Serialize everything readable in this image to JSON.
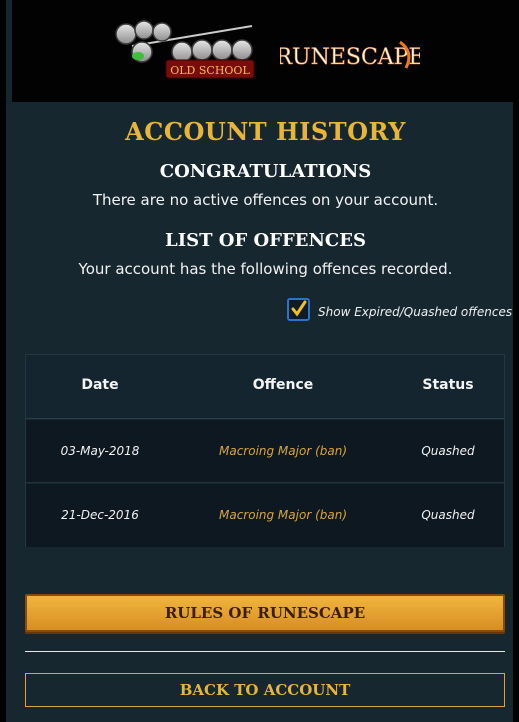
{
  "logos": {
    "osrs_text_1": "RuneScape",
    "osrs_text_2": "OLD SCHOOL",
    "rs_text": "RUNESCAPE"
  },
  "page": {
    "title": "ACCOUNT HISTORY",
    "congrats_heading": "CONGRATULATIONS",
    "congrats_text": "There are no active offences on your account.",
    "list_heading": "LIST OF OFFENCES",
    "list_text": "Your account has the following offences recorded."
  },
  "filter": {
    "label": "Show Expired/Quashed offences",
    "checked": true
  },
  "table": {
    "headers": [
      "Date",
      "Offence",
      "Status"
    ],
    "rows": [
      {
        "date": "03-May-2018",
        "offence": "Macroing Major (ban)",
        "status": "Quashed"
      },
      {
        "date": "21-Dec-2016",
        "offence": "Macroing Major (ban)",
        "status": "Quashed"
      }
    ]
  },
  "buttons": {
    "rules": "RULES OF RUNESCAPE",
    "back": "BACK TO ACCOUNT"
  },
  "colors": {
    "accent_gold": "#e8b534",
    "offence_text": "#d9a63a",
    "background": "#172730"
  }
}
